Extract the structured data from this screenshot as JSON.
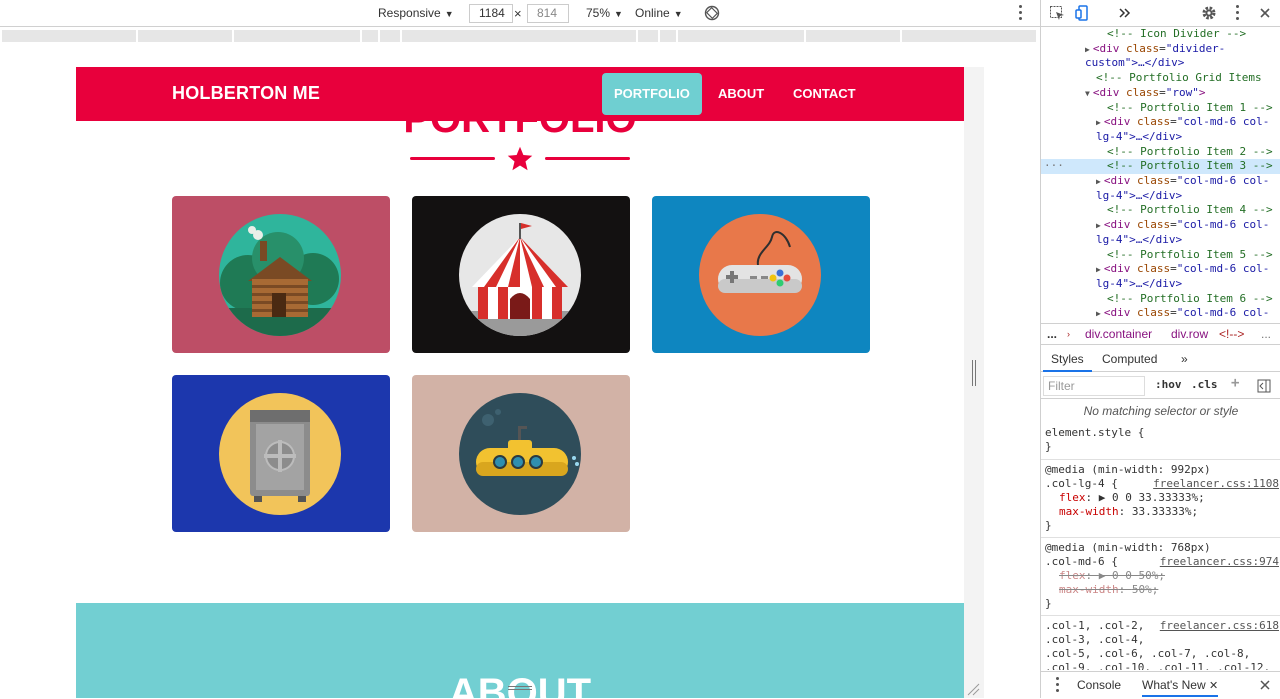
{
  "toolbar": {
    "device": "Responsive",
    "width": "1184",
    "times": "×",
    "height": "814",
    "zoom": "75%",
    "network": "Online"
  },
  "site": {
    "brand": "HOLBERTON ME",
    "nav": [
      "PORTFOLIO",
      "ABOUT",
      "CONTACT"
    ],
    "active_nav": "PORTFOLIO",
    "section_title": "PORTFOLIO",
    "about_title": "ABOUT",
    "colors": {
      "primary": "#e8003c",
      "accent": "#6fcfd1",
      "card1": "#bd4e66",
      "card2": "#131111",
      "card3": "#0e86c0",
      "card4": "#1c37ad",
      "card5": "#d2b2a6"
    },
    "portfolio_items": [
      {
        "icon": "cabin-icon"
      },
      {
        "icon": "circus-tent-icon"
      },
      {
        "icon": "game-controller-icon"
      },
      {
        "icon": "safe-icon"
      },
      {
        "icon": "submarine-icon"
      }
    ]
  },
  "devtools": {
    "dom_lines": [
      {
        "indent": 6,
        "kind": "comment",
        "text": "<!-- Icon Divider -->"
      },
      {
        "indent": 4,
        "kind": "tagopen",
        "tri": "▶",
        "pre": "<div ",
        "attr": "class",
        "val": "\"divider-",
        "post": ""
      },
      {
        "indent": 4,
        "kind": "cont",
        "text": "custom\">…</div>"
      },
      {
        "indent": 5,
        "kind": "comment",
        "text": "<!-- Portfolio Grid Items"
      },
      {
        "indent": 4,
        "kind": "tagopen",
        "tri": "▼",
        "pre": "<div ",
        "attr": "class",
        "val": "\"row\"",
        "post": ">"
      },
      {
        "indent": 6,
        "kind": "comment",
        "text": "<!-- Portfolio Item 1 -->"
      },
      {
        "indent": 5,
        "kind": "tagopen",
        "tri": "▶",
        "pre": "<div ",
        "attr": "class",
        "val": "\"col-md-6 col-",
        "post": ""
      },
      {
        "indent": 5,
        "kind": "cont",
        "text": "lg-4\">…</div>"
      },
      {
        "indent": 6,
        "kind": "comment",
        "text": "<!-- Portfolio Item 2 -->"
      },
      {
        "indent": 6,
        "kind": "comment",
        "text": "<!-- Portfolio Item 3 -->",
        "selected": true
      },
      {
        "indent": 5,
        "kind": "tagopen",
        "tri": "▶",
        "pre": "<div ",
        "attr": "class",
        "val": "\"col-md-6 col-",
        "post": ""
      },
      {
        "indent": 5,
        "kind": "cont",
        "text": "lg-4\">…</div>"
      },
      {
        "indent": 6,
        "kind": "comment",
        "text": "<!-- Portfolio Item 4 -->"
      },
      {
        "indent": 5,
        "kind": "tagopen",
        "tri": "▶",
        "pre": "<div ",
        "attr": "class",
        "val": "\"col-md-6 col-",
        "post": ""
      },
      {
        "indent": 5,
        "kind": "cont",
        "text": "lg-4\">…</div>"
      },
      {
        "indent": 6,
        "kind": "comment",
        "text": "<!-- Portfolio Item 5 -->"
      },
      {
        "indent": 5,
        "kind": "tagopen",
        "tri": "▶",
        "pre": "<div ",
        "attr": "class",
        "val": "\"col-md-6 col-",
        "post": ""
      },
      {
        "indent": 5,
        "kind": "cont",
        "text": "lg-4\">…</div>"
      },
      {
        "indent": 6,
        "kind": "comment",
        "text": "<!-- Portfolio Item 6 -->"
      },
      {
        "indent": 5,
        "kind": "tagopen",
        "tri": "▶",
        "pre": "<div ",
        "attr": "class",
        "val": "\"col-md-6 col-",
        "post": ""
      }
    ],
    "selected_dots": "...",
    "crumbs": [
      "...",
      "div.container",
      "div.row",
      "<!-->"
    ],
    "tabs": [
      "Styles",
      "Computed",
      "»"
    ],
    "filter_placeholder": "Filter",
    "hov": ":hov",
    "cls": ".cls",
    "plus": "+",
    "no_match": "No matching selector or style",
    "element_style": "element.style {",
    "close_brace": "}",
    "rule1": {
      "media": "@media (min-width: 992px)",
      "selector": ".col-lg-4 {",
      "source": "freelancer.css:1108",
      "props": [
        {
          "name": "flex",
          "value": "▶ 0 0 33.33333%;"
        },
        {
          "name": "max-width",
          "value": "33.33333%;"
        }
      ]
    },
    "rule2": {
      "media": "@media (min-width: 768px)",
      "selector": ".col-md-6 {",
      "source": "freelancer.css:974",
      "props": [
        {
          "name": "flex",
          "value": "▶ 0 0 50%;"
        },
        {
          "name": "max-width",
          "value": "50%;"
        }
      ]
    },
    "rule3": {
      "selector_lines": [
        ".col-1, .col-2,",
        ".col-3, .col-4,",
        ".col-5, .col-6, .col-7, .col-8,",
        ".col-9, .col-10, .col-11, .col-12,"
      ],
      "source": "freelancer.css:618"
    },
    "drawer_tabs": [
      "Console",
      "What's New"
    ]
  }
}
